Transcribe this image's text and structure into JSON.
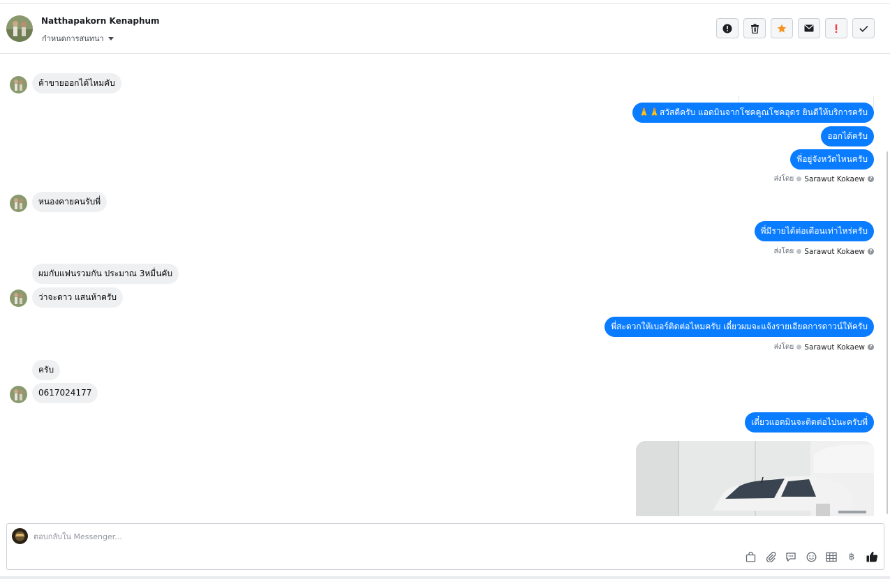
{
  "header": {
    "contact_name": "Natthapakorn Kenaphum",
    "assign_label": "กำหนดการสนทนา",
    "actions": [
      {
        "name": "spam-report-button",
        "icon": "alert-circle-icon"
      },
      {
        "name": "delete-button",
        "icon": "trash-icon"
      },
      {
        "name": "star-button",
        "icon": "star-icon"
      },
      {
        "name": "mark-unread-button",
        "icon": "envelope-icon"
      },
      {
        "name": "follow-up-button",
        "icon": "exclamation-icon"
      },
      {
        "name": "mark-done-button",
        "icon": "check-icon"
      }
    ]
  },
  "messages": {
    "m1": "ค้าขายออกได้ไหมคับ",
    "m2": "🙏🙏สวัสดีครับ แอดมินจากโชคคูณโชคอุดร ยินดีให้บริการครับ",
    "m3": "ออกได้ครับ",
    "m4": "พี่อยู่จังหวัดไหนครับ",
    "m5": "หนองคายคนรับพี่",
    "m6": "พี่มีรายได้ต่อเดือนเท่าไหร่ครับ",
    "m7": "ผมกับแฟนรวมกัน ประมาณ 3หมื่นคับ",
    "m8": "ว่าจะดาว แสนห้าครับ",
    "m9": "พี่สะดวกให้เบอร์ติดต่อไหมครับ เดี๋ยวผมจะแจ้งรายเอียดการดาวน์ให้ครับ",
    "m10": "ครับ",
    "m11": "0617024177",
    "m12": "เดี๋ยวแอดมินจะติดต่อไปนะครับพี่"
  },
  "sent_by": {
    "label": "ส่งโดย",
    "agent": "Sarawut Kokaew",
    "help": "?"
  },
  "composer": {
    "placeholder": "ตอบกลับใน Messenger...",
    "tools": [
      "bag-icon",
      "paperclip-icon",
      "saved-reply-icon",
      "emoji-icon",
      "table-icon",
      "baht-icon",
      "like-icon"
    ],
    "baht_symbol": "฿"
  },
  "colors": {
    "outgoing_bubble": "#0a7cff",
    "incoming_bubble": "#eff0f2",
    "star_accent": "#f7931e",
    "followup_red": "#fa383e"
  }
}
